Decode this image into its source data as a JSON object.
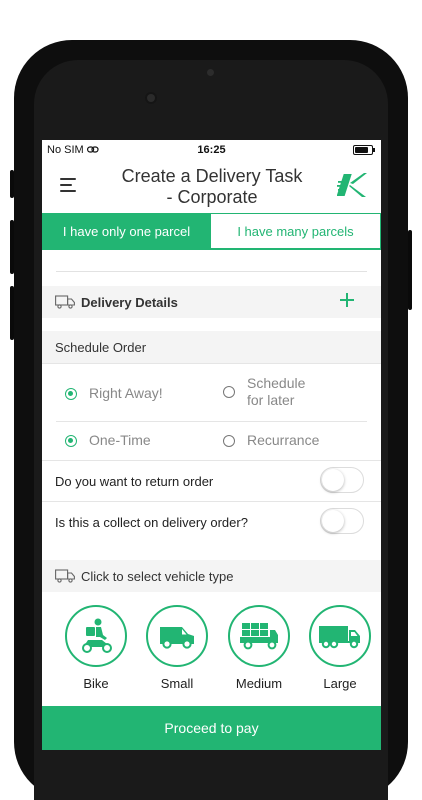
{
  "status": {
    "carrier": "No SIM",
    "time": "16:25"
  },
  "header": {
    "title_line1": "Create a Delivery Task",
    "title_line2": "- Corporate"
  },
  "tabs": [
    {
      "label": "I have only one parcel",
      "active": true
    },
    {
      "label": "I have many parcels",
      "active": false
    }
  ],
  "delivery_details": {
    "label": "Delivery Details"
  },
  "schedule": {
    "label": "Schedule Order",
    "options_when": [
      {
        "label": "Right Away!",
        "selected": true
      },
      {
        "label_line1": "Schedule",
        "label_line2": "for later",
        "selected": false
      }
    ],
    "options_freq": [
      {
        "label": "One-Time",
        "selected": true
      },
      {
        "label": "Recurrance",
        "selected": false
      }
    ]
  },
  "toggles": [
    {
      "label": "Do you want to return order",
      "on": false
    },
    {
      "label": "Is this a collect on delivery order?",
      "on": false
    }
  ],
  "vehicle_section": {
    "label": "Click to select vehicle type"
  },
  "vehicles": [
    {
      "label": "Bike",
      "icon": "bike-icon"
    },
    {
      "label": "Small",
      "icon": "small-van-icon"
    },
    {
      "label": "Medium",
      "icon": "medium-truck-icon"
    },
    {
      "label": "Large",
      "icon": "large-truck-icon"
    }
  ],
  "proceed": {
    "label": "Proceed to pay"
  },
  "colors": {
    "accent": "#22b573"
  }
}
